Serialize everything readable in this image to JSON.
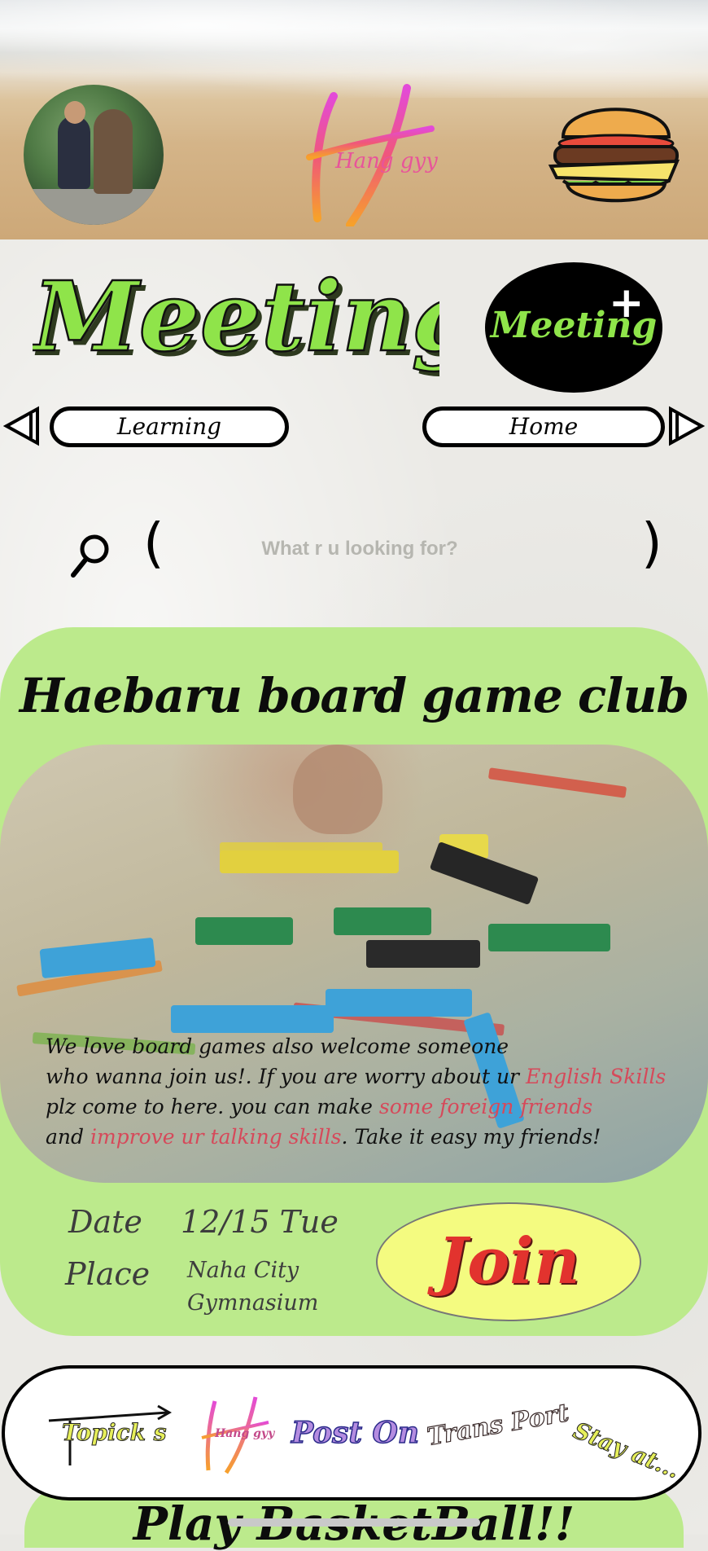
{
  "header": {
    "logo_text": "Hang gyy",
    "avatar_icon": "profile-avatar",
    "menu_icon": "burger-icon"
  },
  "section": {
    "title": "Meeting",
    "new_button_label": "Meeting",
    "new_button_icon": "plus-icon",
    "prev_label": "Learning",
    "next_label": "Home"
  },
  "search": {
    "placeholder": "What r u looking for?",
    "open_paren": "(",
    "close_paren": ")"
  },
  "event": {
    "title": "Haebaru board game club",
    "desc_1": "We love board games also welcome someone",
    "desc_2a": "who wanna join us!. If you are worry about ur ",
    "desc_2b": "English Skills",
    "desc_3a": "plz come to here. you can make ",
    "desc_3b": "some foreign friends",
    "desc_4a": "and ",
    "desc_4b": "improve ur talking skills",
    "desc_4c": ".  Take it easy my friends!",
    "date_label": "Date",
    "date_value": "12/15 Tue",
    "place_label": "Place",
    "place_line1": "Naha City",
    "place_line2": "Gymnasium",
    "join_label": "Join",
    "highlight_color": "#d6495a",
    "card_color": "#bcea8c"
  },
  "bottom_nav": {
    "items": [
      {
        "label": "Topick s"
      },
      {
        "label": "Hang gyy"
      },
      {
        "label": "Post On"
      },
      {
        "label": "Trans Port"
      },
      {
        "label": "Stay at..."
      }
    ]
  },
  "next_event": {
    "title": "Play BasketBall!!"
  }
}
